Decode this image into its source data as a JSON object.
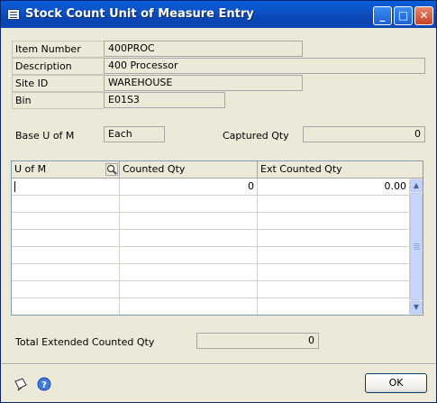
{
  "window": {
    "title": "Stock Count Unit of Measure Entry",
    "title_buttons": {
      "minimize": "_",
      "maximize": "□",
      "close": "✕"
    }
  },
  "fields": {
    "item_number": {
      "label": "Item Number",
      "value": "400PROC"
    },
    "description": {
      "label": "Description",
      "value": "400 Processor"
    },
    "site_id": {
      "label": "Site ID",
      "value": "WAREHOUSE"
    },
    "bin": {
      "label": "Bin",
      "value": "E01S3"
    },
    "base_uofm": {
      "label": "Base U of M",
      "value": "Each"
    },
    "captured_qty": {
      "label": "Captured Qty",
      "value": "0"
    }
  },
  "grid": {
    "columns": [
      "U of M",
      "Counted Qty",
      "Ext Counted Qty"
    ],
    "rows": [
      {
        "uofm": "",
        "counted_qty": "0",
        "ext_counted_qty": "0.00"
      }
    ],
    "scroll_up": "▲",
    "scroll_down": "▼"
  },
  "total": {
    "label": "Total Extended Counted Qty",
    "value": "0"
  },
  "footer": {
    "ok_label": "OK",
    "icons": [
      "note-icon",
      "help-icon"
    ]
  },
  "colors": {
    "titlebar": "#0b4fc3",
    "window_bg": "#ece9d8",
    "field_border": "#a7a6aa"
  }
}
